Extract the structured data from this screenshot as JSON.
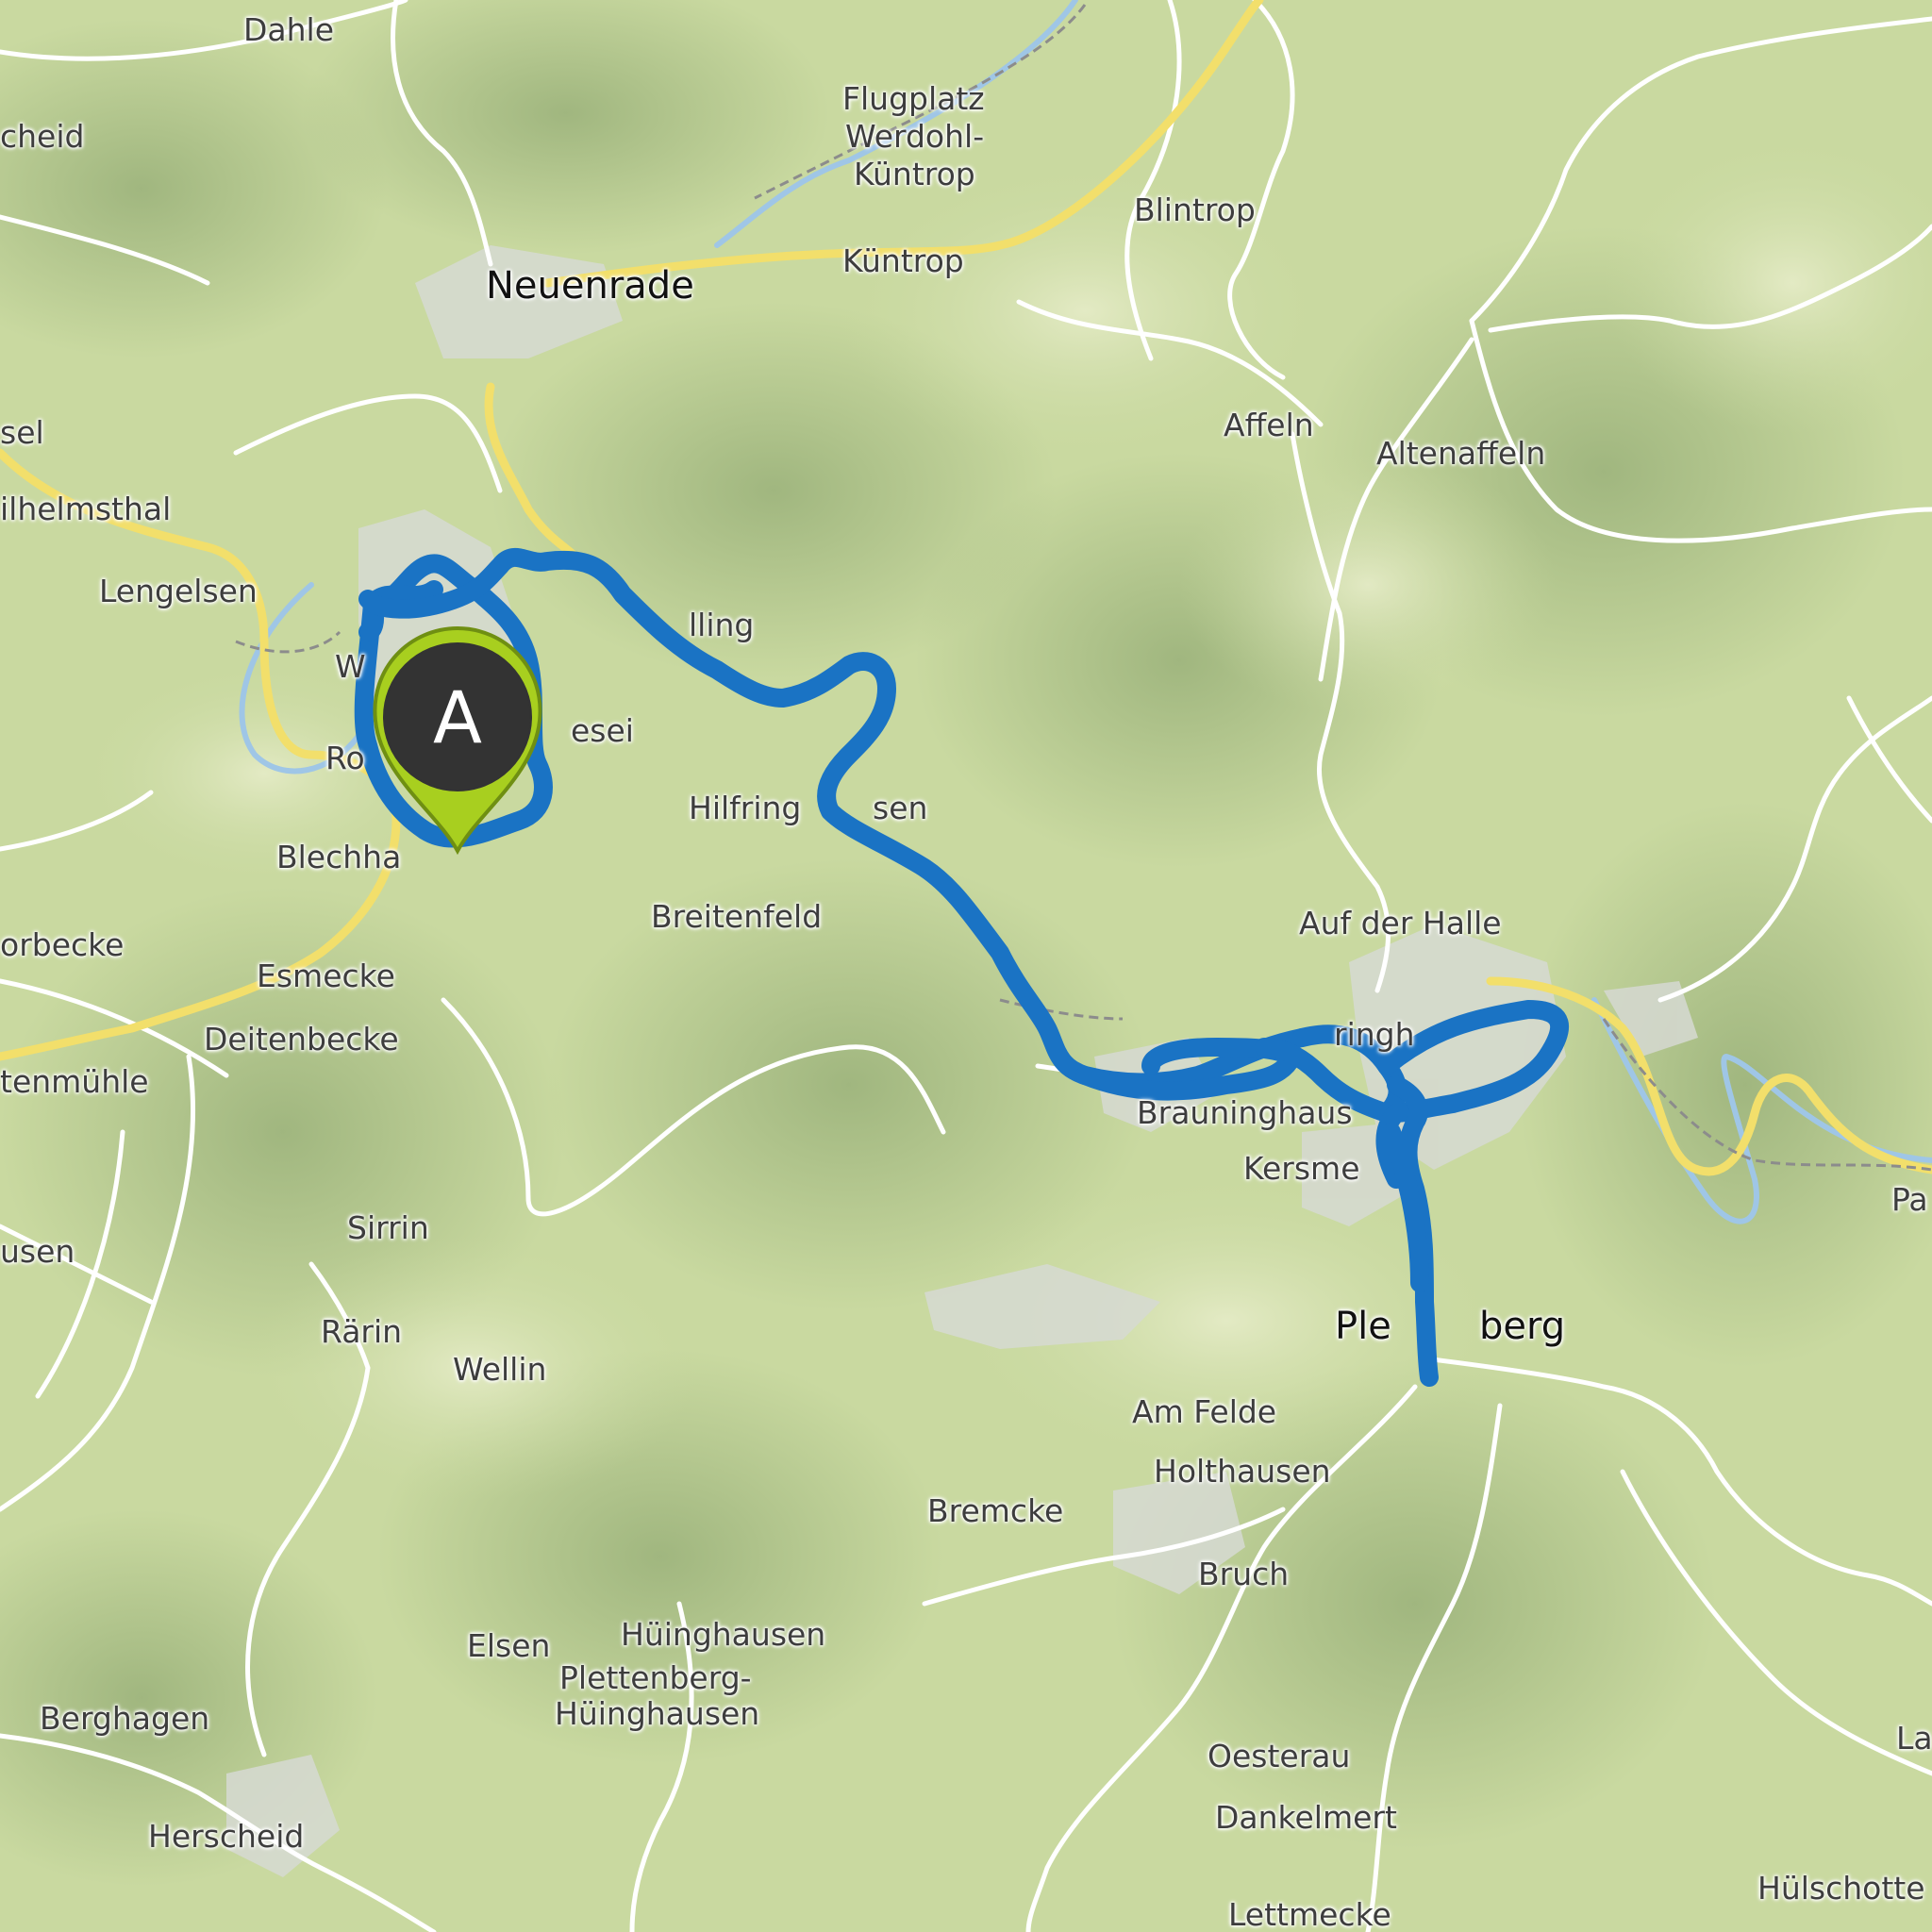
{
  "map": {
    "colors": {
      "terrain": "#c9d9a0",
      "terrain_light": "#e4ebc6",
      "terrain_shadow": "#7f9a64",
      "settlement": "#d6d9d2",
      "road_major": "#f2df6b",
      "road_minor": "#ffffff",
      "river": "#9fc6e6",
      "route": "#1a73c4",
      "marker_fill": "#a8cf1f",
      "marker_center": "#333333"
    },
    "marker": {
      "label": "A"
    },
    "places": [
      {
        "id": "dahle",
        "name": "Dahle"
      },
      {
        "id": "scheid",
        "name": "cheid"
      },
      {
        "id": "flugplatz1",
        "name": "Flugplatz"
      },
      {
        "id": "flugplatz2",
        "name": "Werdohl-"
      },
      {
        "id": "flugplatz3",
        "name": "Küntrop"
      },
      {
        "id": "blintrop",
        "name": "Blintrop"
      },
      {
        "id": "neuenrade",
        "name": "Neuenrade"
      },
      {
        "id": "kuentrop",
        "name": "Küntrop"
      },
      {
        "id": "sel",
        "name": "sel"
      },
      {
        "id": "affeln",
        "name": "Affeln"
      },
      {
        "id": "altenaffeln",
        "name": "Altenaffeln"
      },
      {
        "id": "wilhelmsthal",
        "name": "ilhelmsthal"
      },
      {
        "id": "lengelsen",
        "name": "Lengelsen"
      },
      {
        "id": "lling",
        "name": "lling"
      },
      {
        "id": "w",
        "name": "W"
      },
      {
        "id": "esei",
        "name": "esei"
      },
      {
        "id": "ro",
        "name": "Ro"
      },
      {
        "id": "hilfringhausen",
        "name": "Hilfring"
      },
      {
        "id": "hilfringhausen2",
        "name": "sen"
      },
      {
        "id": "blechha",
        "name": "Blechha"
      },
      {
        "id": "breitenfeld",
        "name": "Breitenfeld"
      },
      {
        "id": "aufderhalle",
        "name": "Auf der Halle"
      },
      {
        "id": "orbecke",
        "name": "orbecke"
      },
      {
        "id": "esmecke",
        "name": "Esmecke"
      },
      {
        "id": "deitenbecke",
        "name": "Deitenbecke"
      },
      {
        "id": "tenmuehle",
        "name": "tenmühle"
      },
      {
        "id": "ringh",
        "name": "ringh"
      },
      {
        "id": "brauninghaus",
        "name": "Brauninghaus"
      },
      {
        "id": "kersme",
        "name": "Kersme"
      },
      {
        "id": "pa",
        "name": "Pa"
      },
      {
        "id": "sirrin",
        "name": "Sirrin"
      },
      {
        "id": "usen",
        "name": "usen"
      },
      {
        "id": "raerin",
        "name": "Rärin"
      },
      {
        "id": "wellin",
        "name": "Wellin"
      },
      {
        "id": "plettenberg1",
        "name": "Ple"
      },
      {
        "id": "plettenberg2",
        "name": "berg"
      },
      {
        "id": "amfelde",
        "name": "Am Felde"
      },
      {
        "id": "holthausen",
        "name": "Holthausen"
      },
      {
        "id": "bremcke",
        "name": "Bremcke"
      },
      {
        "id": "bruch",
        "name": "Bruch"
      },
      {
        "id": "elsen",
        "name": "Elsen"
      },
      {
        "id": "hueinghausen",
        "name": "Hüinghausen"
      },
      {
        "id": "phuein1",
        "name": "Plettenberg-"
      },
      {
        "id": "phuein2",
        "name": "Hüinghausen"
      },
      {
        "id": "berghagen",
        "name": "Berghagen"
      },
      {
        "id": "la",
        "name": "La"
      },
      {
        "id": "oesterau",
        "name": "Oesterau"
      },
      {
        "id": "dankelmert",
        "name": "Dankelmert"
      },
      {
        "id": "herscheid",
        "name": "Herscheid"
      },
      {
        "id": "huelschotten",
        "name": "Hülschotte"
      },
      {
        "id": "lettmecke",
        "name": "Lettmecke"
      }
    ]
  }
}
